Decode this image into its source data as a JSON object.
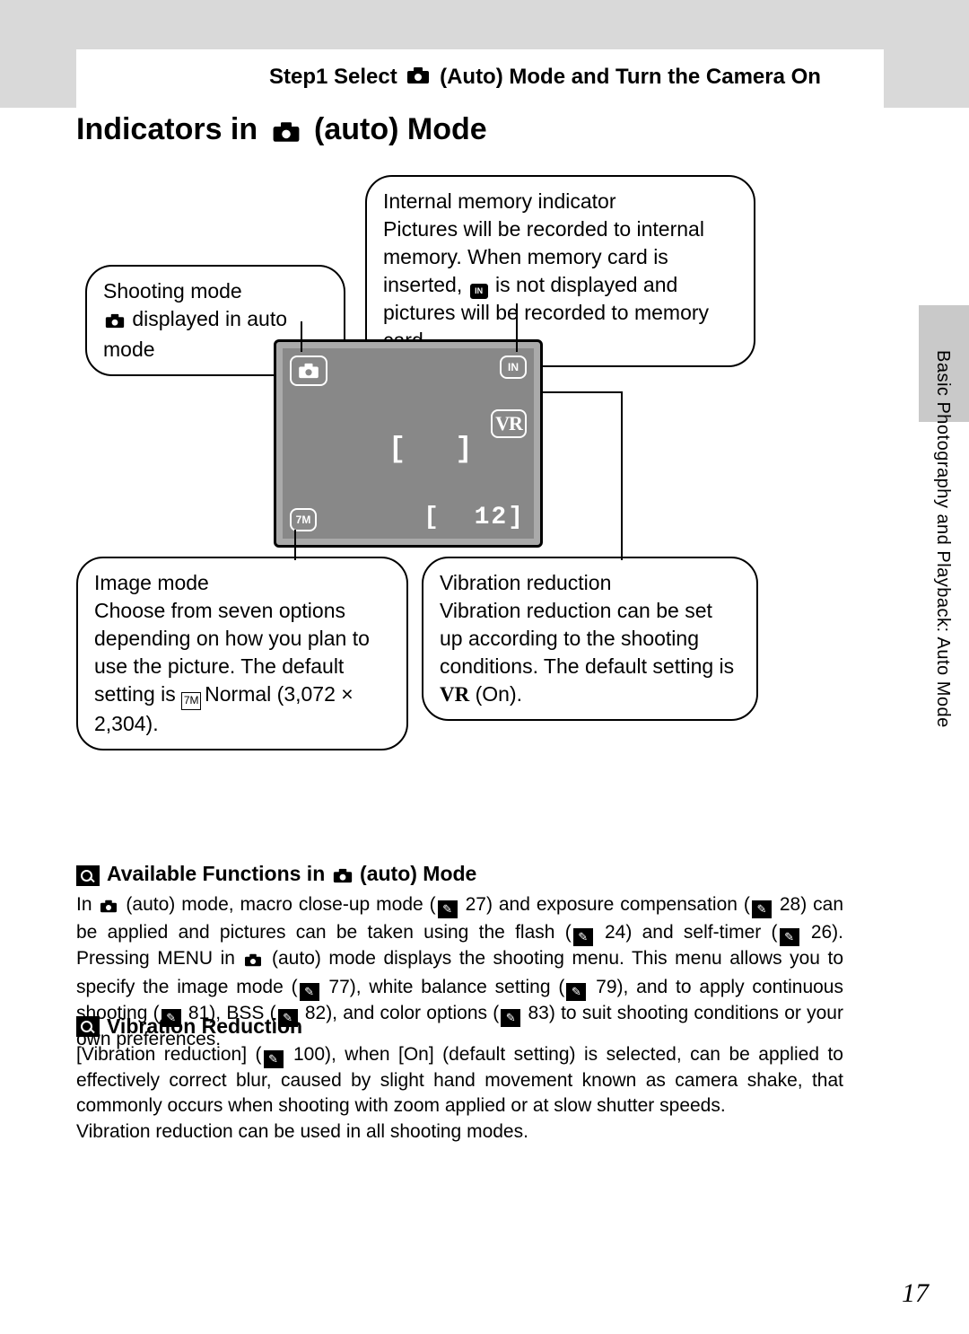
{
  "running_head": {
    "prefix": "Step1 Select",
    "suffix": "(Auto) Mode and Turn the Camera On"
  },
  "title": {
    "prefix": "Indicators in",
    "suffix": "(auto) Mode"
  },
  "side_label": "Basic Photography and Playback: Auto Mode",
  "callouts": {
    "shooting": {
      "line1": "Shooting mode",
      "line2": "displayed in auto mode"
    },
    "memory": {
      "title": "Internal memory indicator",
      "body1": "Pictures will be recorded to internal memory. When memory card is inserted,",
      "body2": "is not displayed and pictures will be recorded to memory card."
    },
    "image": {
      "title": "Image mode",
      "body": "Choose from seven options depending on how you plan to use the picture. The default setting is",
      "default": "Normal (3,072 × 2,304)."
    },
    "vr": {
      "title": "Vibration reduction",
      "body": "Vibration reduction can be set up according to the shooting conditions. The default setting is",
      "default": "(On)."
    }
  },
  "lcd": {
    "shots_remaining": "12",
    "vr_label": "VR",
    "in_label": "IN",
    "px_label": "7M"
  },
  "notes": {
    "available": {
      "heading_prefix": "Available Functions in",
      "heading_suffix": "(auto) Mode",
      "t1": "In ",
      "t2": " (auto) mode, macro close-up mode (",
      "p27": "27",
      "t3": ") and exposure compensation (",
      "p28": "28",
      "t4": ") can be applied and pictures can be taken using the flash (",
      "p24": "24",
      "t5": ") and self-timer (",
      "p26": "26",
      "t6": "). Pressing ",
      "menu": "MENU",
      "t7": " in ",
      "t8": " (auto) mode displays the shooting menu. This menu allows you to specify the image mode (",
      "p77": "77",
      "t9": "), white balance setting (",
      "p79": "79",
      "t10": "), and to apply continuous shooting (",
      "p81": "81",
      "t11": "), BSS (",
      "p82": "82",
      "t12": "), and color options (",
      "p83": "83",
      "t13": ") to suit shooting conditions or your own preferences."
    },
    "vibration": {
      "heading": "Vibration Reduction",
      "t1": "[Vibration reduction] (",
      "p100": "100",
      "t2": "), when [On] (default setting) is selected, can be applied to effectively correct blur, caused by slight hand movement known as camera shake, that commonly occurs when shooting with zoom applied or at slow shutter speeds.",
      "t3": "Vibration reduction can be used in all shooting modes."
    }
  },
  "page_number": "17"
}
